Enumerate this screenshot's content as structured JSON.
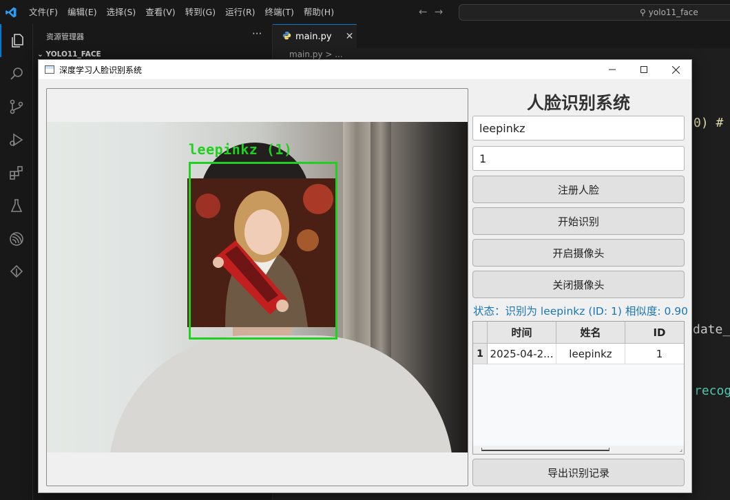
{
  "vscode": {
    "menu": [
      "文件(F)",
      "编辑(E)",
      "选择(S)",
      "查看(V)",
      "转到(G)",
      "运行(R)",
      "终端(T)",
      "帮助(H)"
    ],
    "search_text": "yolo11_face",
    "explorer_title": "资源管理器",
    "folder_name": "YOLO11_FACE",
    "tab_label": "main.py",
    "breadcrumb": "main.py > ...",
    "code_fragments": [
      "0)  #",
      "date_",
      "recog"
    ]
  },
  "app": {
    "window_title": "深度学习人脸识别系统",
    "panel_title": "人脸识别系统",
    "name_input": "leepinkz",
    "id_input": "1",
    "buttons": {
      "register": "注册人脸",
      "start_recognition": "开始识别",
      "open_camera": "开启摄像头",
      "close_camera": "关闭摄像头",
      "export": "导出识别记录"
    },
    "status": "状态：识别为 leepinkz (ID: 1) 相似度: 0.90",
    "detection_label": "leepinkz (1)",
    "table": {
      "columns": [
        "时间",
        "姓名",
        "ID"
      ],
      "rows": [
        {
          "index": "1",
          "time": "2025-04-2...",
          "name": "leepinkz",
          "id": "1"
        }
      ]
    }
  },
  "colors": {
    "detection_box": "#20d020",
    "status_text": "#1b76b5",
    "vscode_accent": "#0078d4"
  },
  "icons": [
    "vscode-logo-icon",
    "explorer-icon",
    "search-icon",
    "source-control-icon",
    "run-debug-icon",
    "extensions-icon",
    "testing-icon",
    "remote-icon",
    "python-icon",
    "minimize-icon",
    "maximize-icon",
    "close-icon"
  ]
}
